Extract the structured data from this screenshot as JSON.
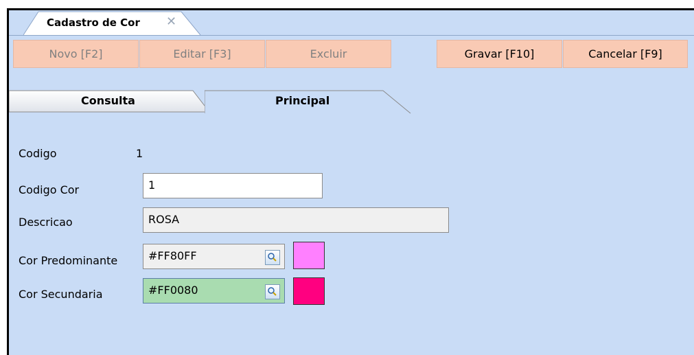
{
  "document_tab": {
    "title": "Cadastro de Cor",
    "close_symbol": "✕"
  },
  "toolbar": {
    "buttons": [
      {
        "label": "Novo [F2]",
        "enabled": false
      },
      {
        "label": "Editar [F3]",
        "enabled": false
      },
      {
        "label": "Excluir",
        "enabled": false
      },
      {
        "label": "Gravar [F10]",
        "enabled": true
      },
      {
        "label": "Cancelar [F9]",
        "enabled": true
      }
    ],
    "button_color": "#f9cab4"
  },
  "tabs": [
    {
      "label": "Consulta",
      "active": false
    },
    {
      "label": "Principal",
      "active": true
    }
  ],
  "form": {
    "codigo": {
      "label": "Codigo",
      "value": "1"
    },
    "codigo_cor": {
      "label": "Codigo Cor",
      "value": "1"
    },
    "descricao": {
      "label": "Descricao",
      "value": "ROSA"
    },
    "cor_predominante": {
      "label": "Cor Predominante",
      "value": "#FF80FF",
      "swatch_color": "#FF80FF"
    },
    "cor_secundaria": {
      "label": "Cor Secundaria",
      "value": "#FF0080",
      "swatch_color": "#FF0080"
    }
  },
  "colors": {
    "background": "#c9dcf6",
    "focused_field": "#a9dcb0"
  }
}
